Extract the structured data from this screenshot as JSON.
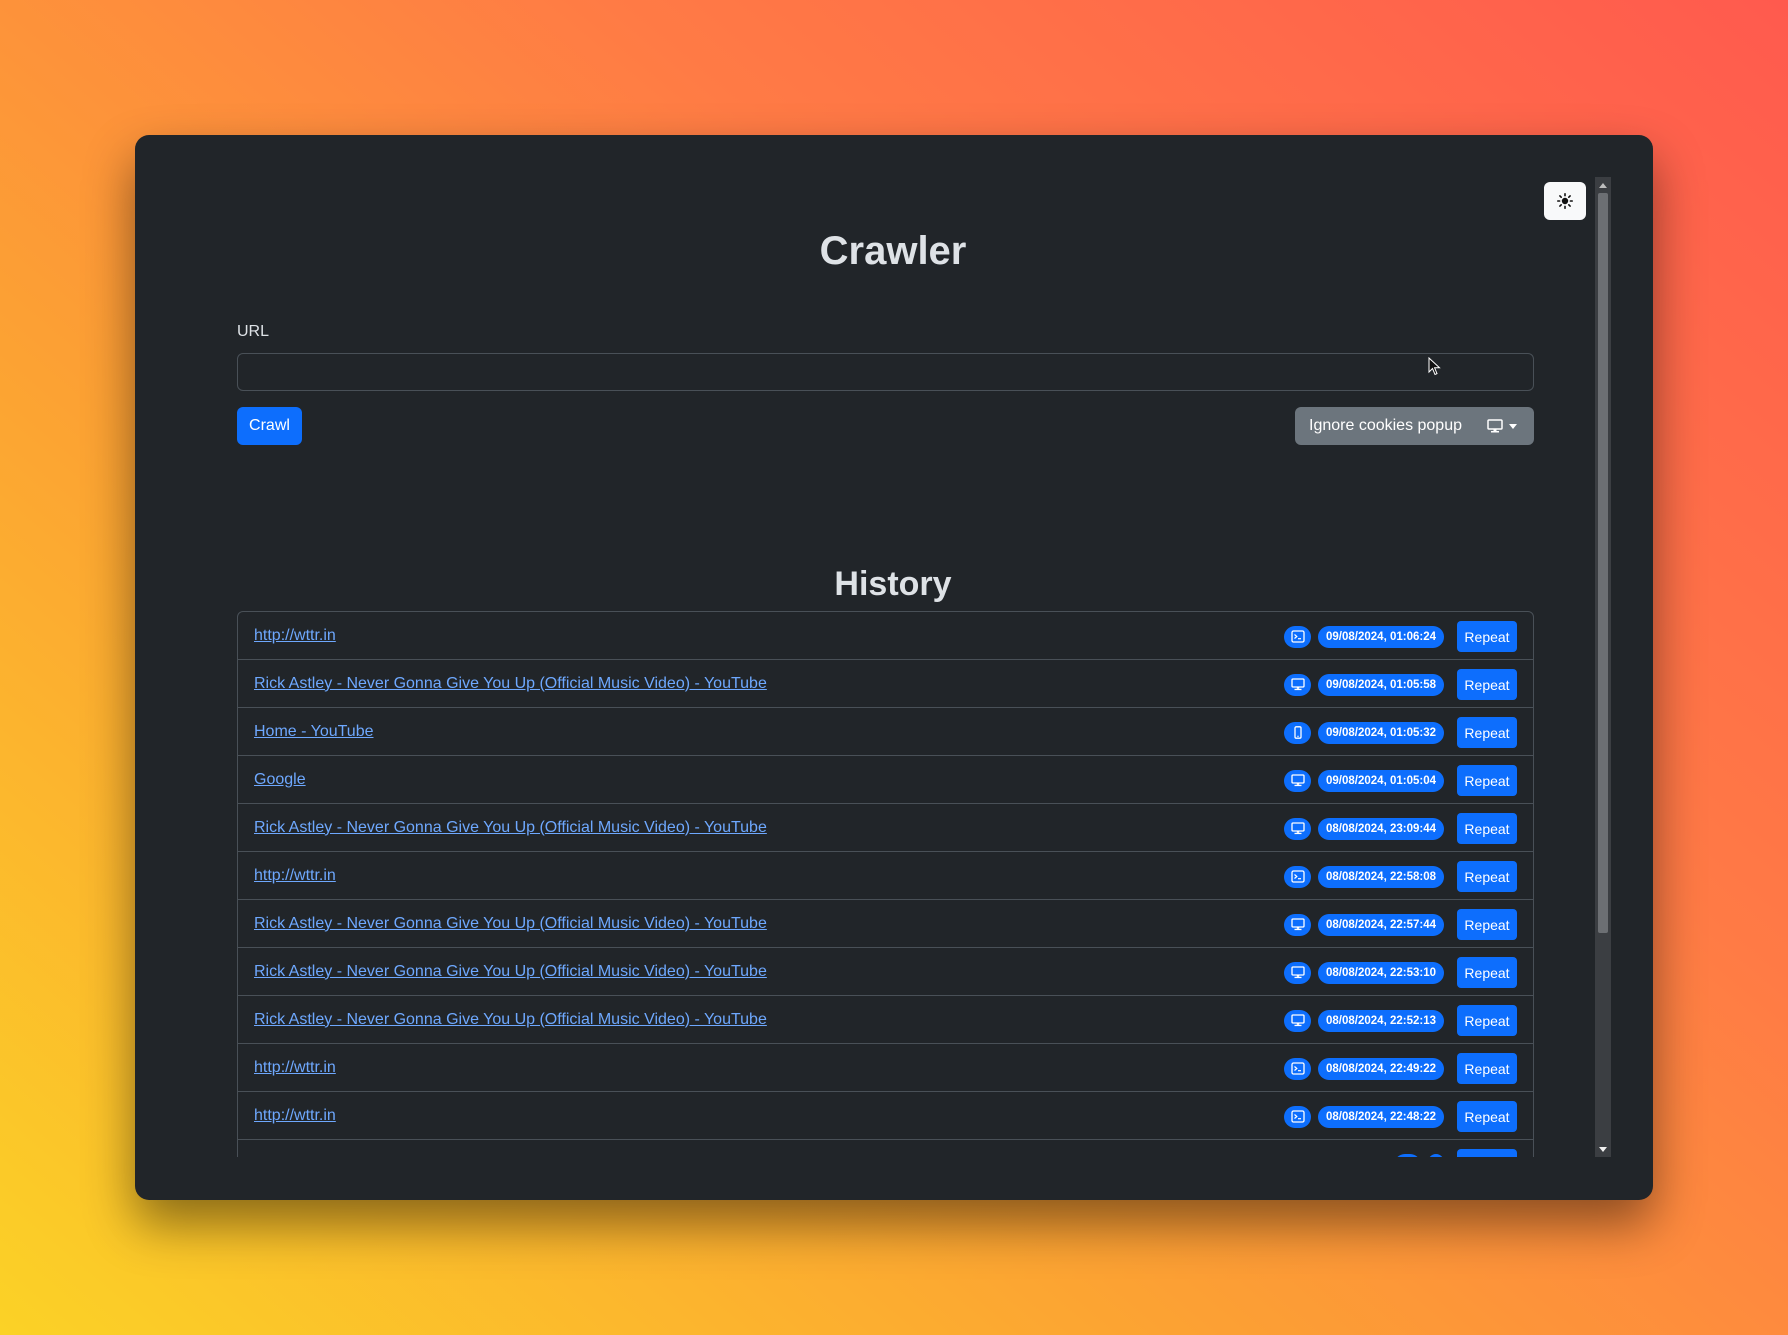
{
  "header": {
    "title": "Crawler"
  },
  "theme_toggle": {
    "icon": "sun-icon"
  },
  "form": {
    "url_label": "URL",
    "url_value": "",
    "url_placeholder": "",
    "crawl_label": "Crawl",
    "ignore_cookies_label": "Ignore cookies popup",
    "device_icon": "desktop-icon"
  },
  "history": {
    "title": "History",
    "repeat_label": "Repeat",
    "items": [
      {
        "title": "http://wttr.in",
        "device": "terminal",
        "timestamp": "09/08/2024, 01:06:24"
      },
      {
        "title": "Rick Astley - Never Gonna Give You Up (Official Music Video) - YouTube",
        "device": "desktop",
        "timestamp": "09/08/2024, 01:05:58"
      },
      {
        "title": "Home - YouTube",
        "device": "mobile",
        "timestamp": "09/08/2024, 01:05:32"
      },
      {
        "title": "Google",
        "device": "desktop",
        "timestamp": "09/08/2024, 01:05:04"
      },
      {
        "title": "Rick Astley - Never Gonna Give You Up (Official Music Video) - YouTube",
        "device": "desktop",
        "timestamp": "08/08/2024, 23:09:44"
      },
      {
        "title": "http://wttr.in",
        "device": "terminal",
        "timestamp": "08/08/2024, 22:58:08"
      },
      {
        "title": "Rick Astley - Never Gonna Give You Up (Official Music Video) - YouTube",
        "device": "desktop",
        "timestamp": "08/08/2024, 22:57:44"
      },
      {
        "title": "Rick Astley - Never Gonna Give You Up (Official Music Video) - YouTube",
        "device": "desktop",
        "timestamp": "08/08/2024, 22:53:10"
      },
      {
        "title": "Rick Astley - Never Gonna Give You Up (Official Music Video) - YouTube",
        "device": "desktop",
        "timestamp": "08/08/2024, 22:52:13"
      },
      {
        "title": "http://wttr.in",
        "device": "terminal",
        "timestamp": "08/08/2024, 22:49:22"
      },
      {
        "title": "http://wttr.in",
        "device": "terminal",
        "timestamp": "08/08/2024, 22:48:22"
      },
      {
        "title": "",
        "device": "desktop",
        "timestamp": ""
      }
    ]
  },
  "colors": {
    "background": "#212529",
    "primary": "#0d6efd",
    "secondary": "#6c757d",
    "link": "#6ea8fe",
    "text": "#dee2e6"
  }
}
